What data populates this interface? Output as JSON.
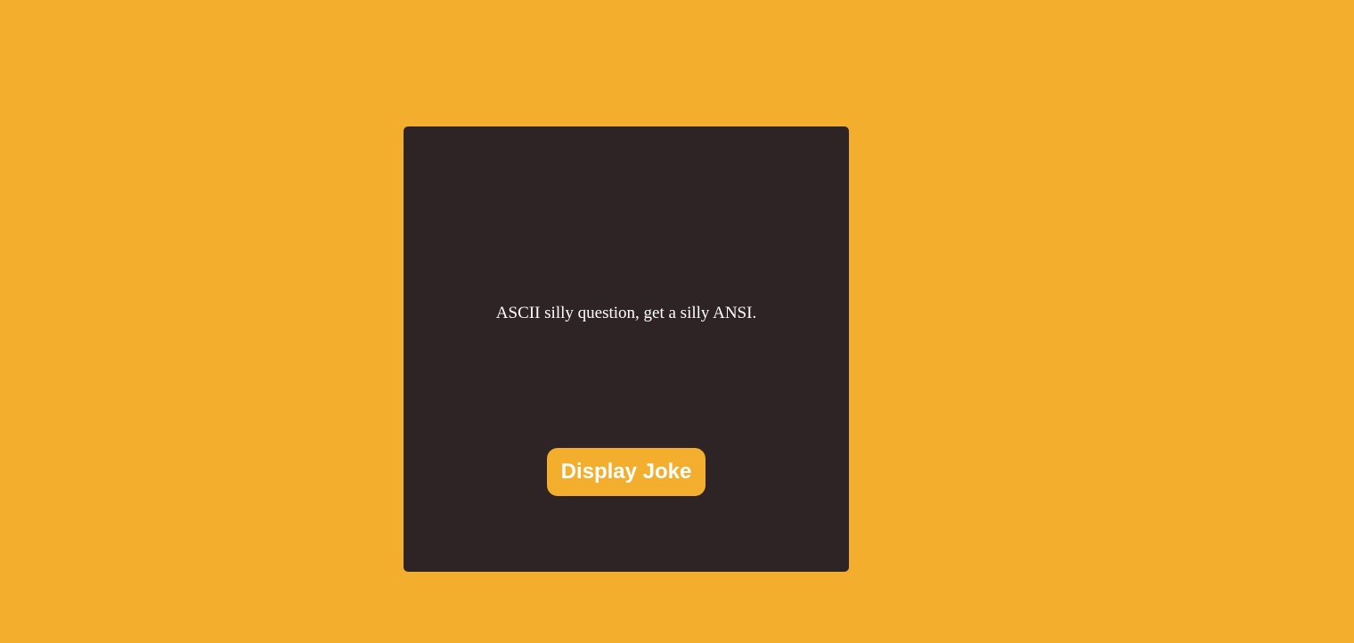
{
  "colors": {
    "page_background": "#f4ae2e",
    "card_background": "#2e2425",
    "text": "#ffffff",
    "button_background": "#f4ae2e"
  },
  "joke": {
    "text": "ASCII silly question, get a silly ANSI."
  },
  "button": {
    "label": "Display Joke"
  }
}
